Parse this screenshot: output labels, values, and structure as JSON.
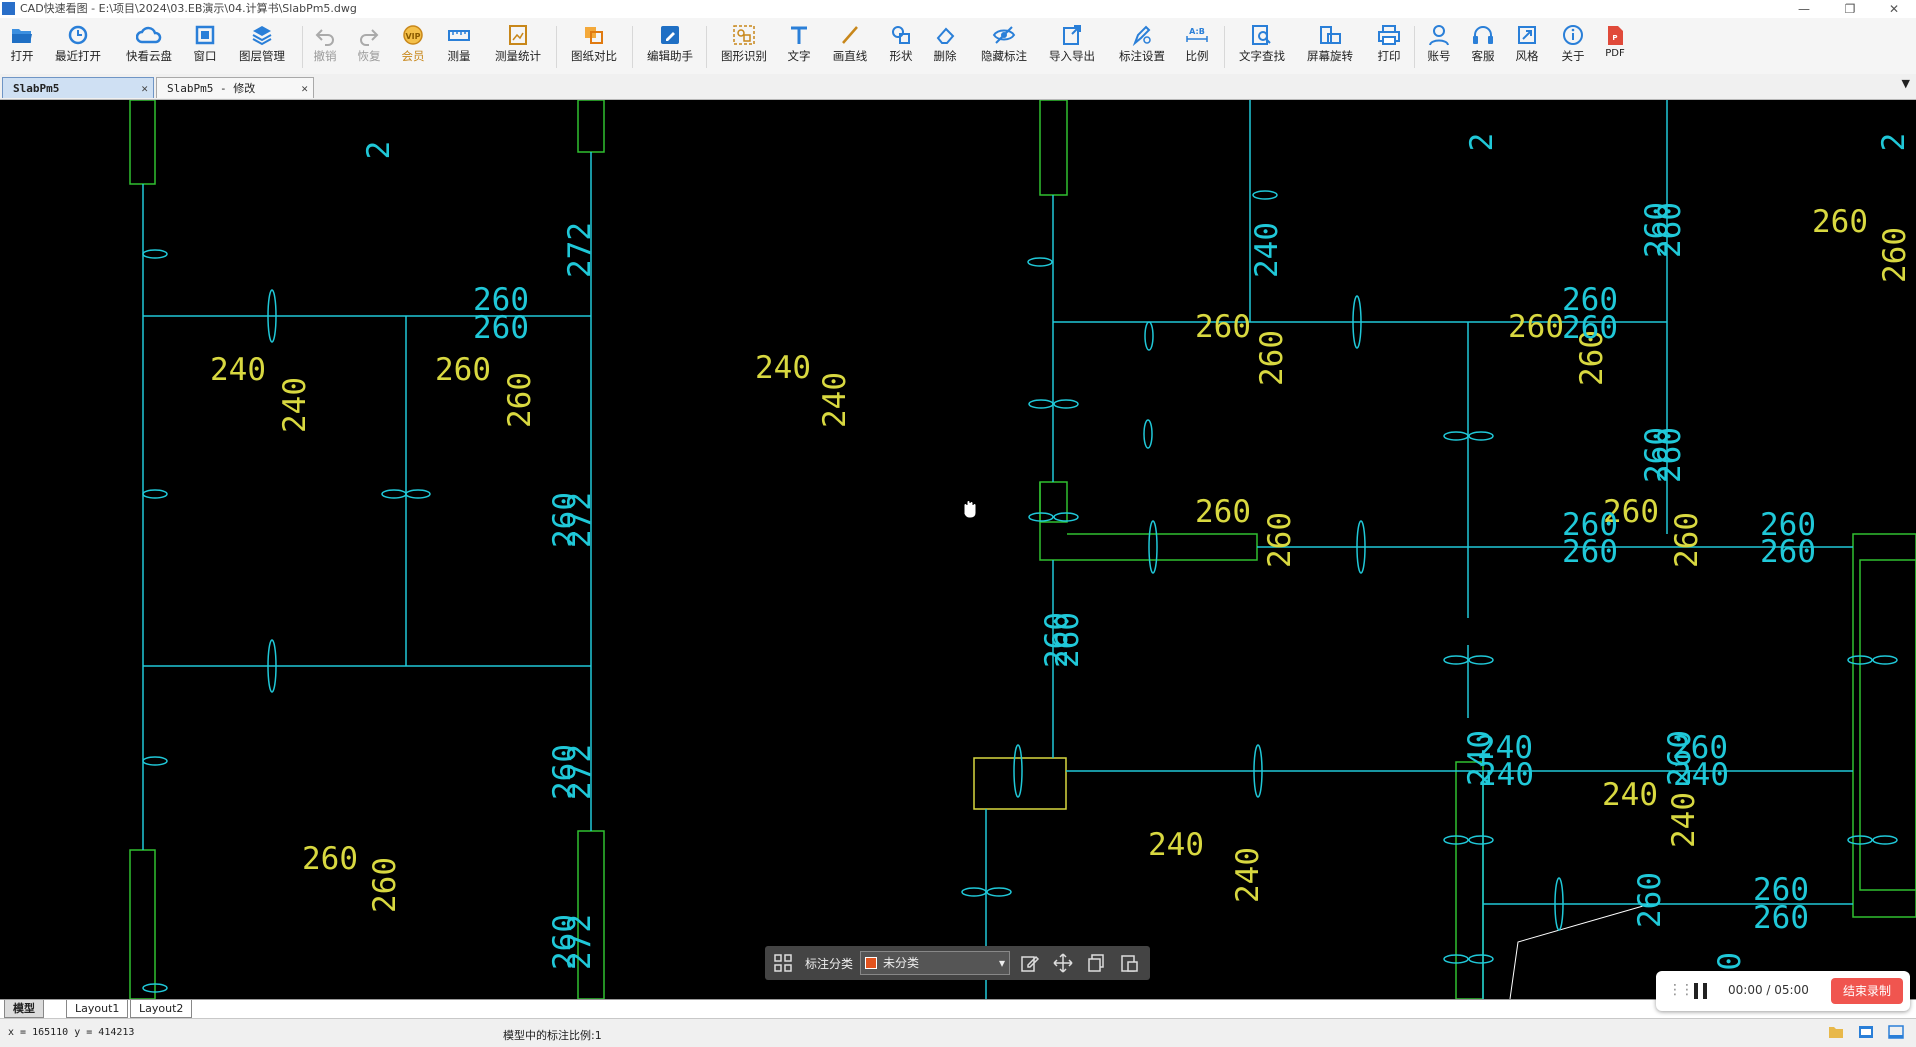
{
  "titlebar": {
    "title": "CAD快速看图 - E:\\项目\\2024\\03.EB演示\\04.计算书\\SlabPm5.dwg",
    "minimize": "—",
    "restore": "❐",
    "close": "✕"
  },
  "toolbar": {
    "open": "打开",
    "recent": "最近打开",
    "cloud": "快看云盘",
    "window": "窗口",
    "layers": "图层管理",
    "undo": "撤销",
    "redo": "恢复",
    "vip": "会员",
    "measure": "测量",
    "measure_stats": "测量统计",
    "compare": "图纸对比",
    "edit_assist": "编辑助手",
    "shape_recog": "图形识别",
    "text": "文字",
    "line": "画直线",
    "shape": "形状",
    "delete": "删除",
    "hide_annot": "隐藏标注",
    "import_export": "导入导出",
    "annot_settings": "标注设置",
    "scale": "比例",
    "text_search": "文字查找",
    "rotate_screen": "屏幕旋转",
    "print": "打印",
    "account": "账号",
    "service": "客服",
    "style": "风格",
    "about": "关于",
    "pdf": "PDF"
  },
  "tabs": {
    "tab1": "SlabPm5",
    "tab2": "SlabPm5 - 修改",
    "close": "✕",
    "menu": "▼"
  },
  "drawing": {
    "yellow_labels": [
      "240",
      "240",
      "260",
      "260",
      "260",
      "260",
      "240",
      "240",
      "260",
      "260",
      "260",
      "260",
      "260",
      "260",
      "240",
      "240",
      "260",
      "260",
      "240",
      "240",
      "260",
      "260"
    ],
    "cyan_labels": [
      "272",
      "260",
      "260",
      "272",
      "260",
      "272",
      "260",
      "272",
      "260",
      "260",
      "260",
      "260",
      "260",
      "260",
      "260",
      "260",
      "260",
      "260",
      "260",
      "260",
      "260",
      "240",
      "260",
      "240",
      "240",
      "260",
      "260",
      "260",
      "240",
      "240",
      "260",
      "260",
      "2",
      "2",
      "2"
    ]
  },
  "floatbar": {
    "label": "标注分类",
    "selected": "未分类",
    "swatch_color": "#e2531e"
  },
  "layouts": {
    "model": "模型",
    "layout1": "Layout1",
    "layout2": "Layout2"
  },
  "status": {
    "coords": "x = 165110  y = 414213",
    "scale_text": "模型中的标注比例:1"
  },
  "recorder": {
    "time": "00:00 / 05:00",
    "stop": "结束录制"
  },
  "colors": {
    "canvas_bg": "#000000",
    "cad_cyan": "#20c8d8",
    "cad_yellow": "#d8d840",
    "cad_green": "#30c030",
    "accent": "#f0554f"
  }
}
